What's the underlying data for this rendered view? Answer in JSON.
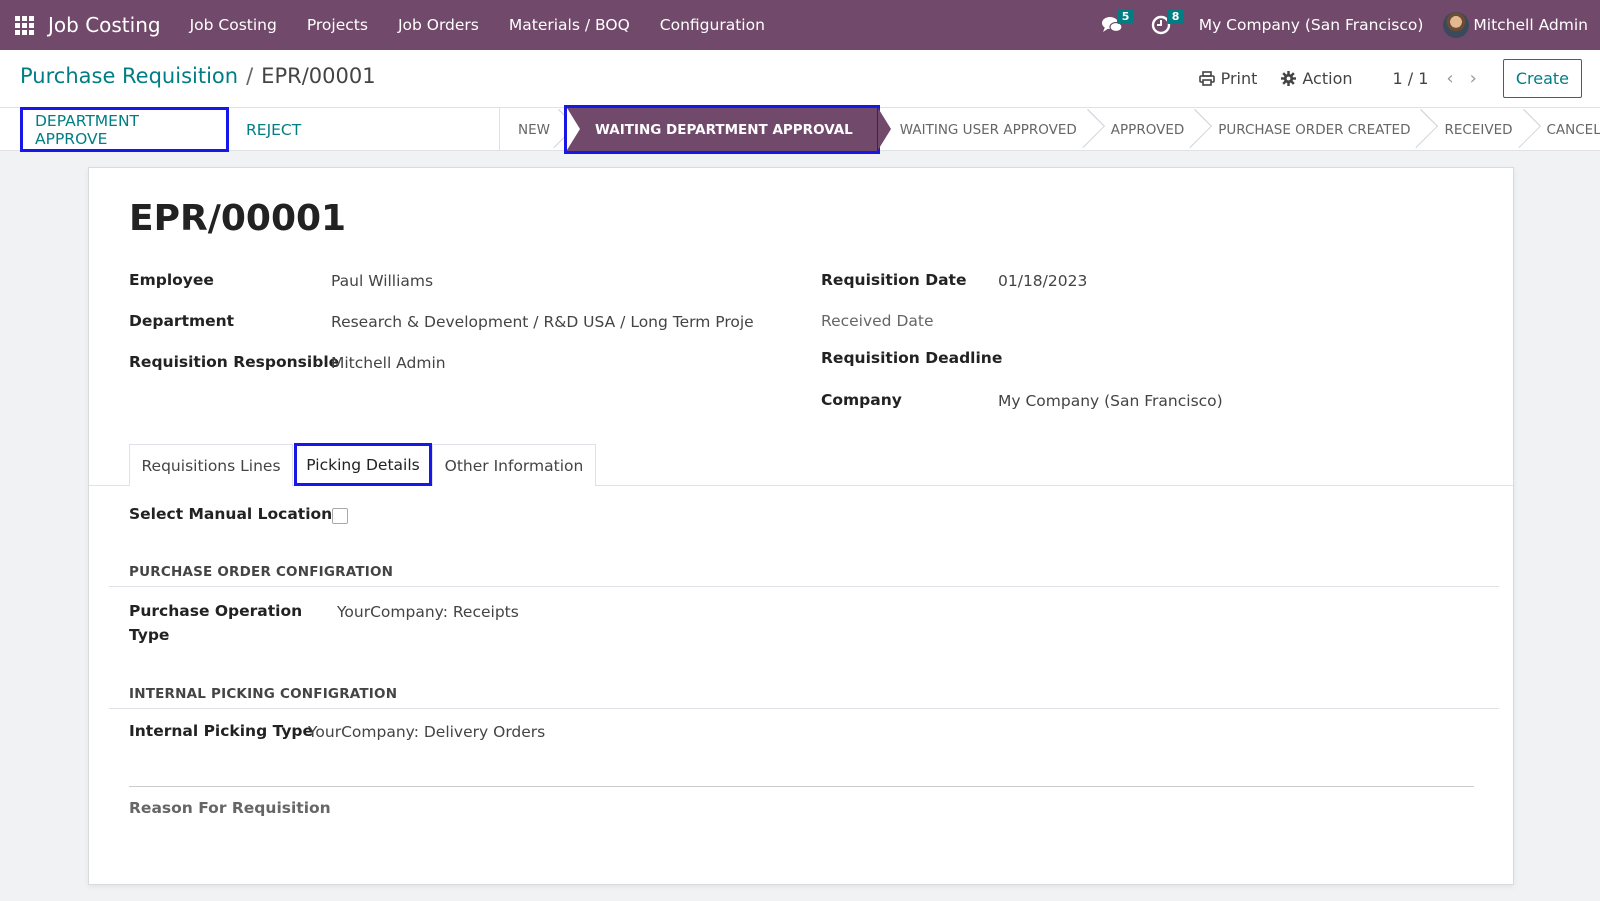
{
  "navbar": {
    "app_name": "Job Costing",
    "menu": [
      "Job Costing",
      "Projects",
      "Job Orders",
      "Materials / BOQ",
      "Configuration"
    ],
    "messages_count": "5",
    "activities_count": "8",
    "company": "My Company (San Francisco)",
    "user": "Mitchell Admin",
    "bg_color": "#71496a"
  },
  "breadcrumb": {
    "parent": "Purchase Requisition",
    "separator": "/",
    "current": "EPR/00001"
  },
  "control_panel": {
    "print_label": "Print",
    "action_label": "Action",
    "pager": "1 / 1",
    "create_label": "Create"
  },
  "statusbar": {
    "buttons": [
      "DEPARTMENT APPROVE",
      "REJECT"
    ],
    "stages": [
      "NEW",
      "WAITING DEPARTMENT APPROVAL",
      "WAITING USER APPROVED",
      "APPROVED",
      "PURCHASE ORDER CREATED",
      "RECEIVED",
      "CANCEL"
    ],
    "active_stage": "WAITING DEPARTMENT APPROVAL",
    "accent_color": "#017e84",
    "highlight_color": "#1717e8"
  },
  "form": {
    "title": "EPR/00001",
    "left_fields": [
      {
        "label": "Employee",
        "value": "Paul Williams"
      },
      {
        "label": "Department",
        "value": "Research & Development / R&D USA / Long Term Proje"
      },
      {
        "label": "Requisition Responsible",
        "value": "Mitchell Admin"
      }
    ],
    "right_fields": [
      {
        "label": "Requisition Date",
        "value": "01/18/2023"
      },
      {
        "label": "Received Date",
        "value": ""
      },
      {
        "label": "Requisition Deadline",
        "value": ""
      },
      {
        "label": "Company",
        "value": "My Company (San Francisco)"
      }
    ],
    "tabs": [
      "Requisitions Lines",
      "Picking Details",
      "Other Information"
    ],
    "active_tab": "Picking Details",
    "manual_locations_label": "Select Manual Locations",
    "manual_locations_checked": false,
    "po_section_title": "PURCHASE ORDER CONFIGRATION",
    "purchase_operation_label_1": "Purchase Operation",
    "purchase_operation_label_2": "Type",
    "purchase_operation_value": "YourCompany: Receipts",
    "internal_section_title": "INTERNAL PICKING CONFIGRATION",
    "internal_picking_label": "Internal Picking Type",
    "internal_picking_value": "YourCompany: Delivery Orders",
    "notes_placeholder": "Reason For Requisition"
  }
}
